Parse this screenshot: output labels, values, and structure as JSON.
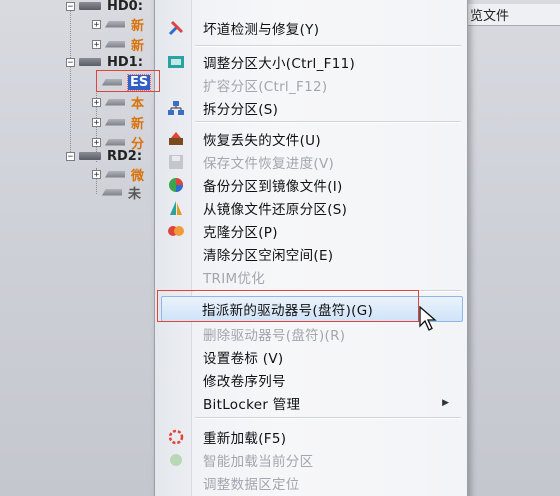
{
  "tree": {
    "hd0_label": "HD0:",
    "hd0_children": [
      "新",
      "新"
    ],
    "hd1_label": "HD1:",
    "hd1_selected": "ES",
    "hd1_children": [
      "本",
      "新",
      "分"
    ],
    "rd2_label": "RD2:",
    "rd2_children": [
      "微",
      "未"
    ]
  },
  "right_header": "览文件",
  "menu": {
    "items": [
      {
        "label": "坏道检测与修复(Y)",
        "disabled": false,
        "icon": "wrench-icon"
      },
      {
        "label": "调整分区大小(Ctrl_F11)",
        "disabled": false,
        "icon": "resize-icon"
      },
      {
        "label": "扩容分区(Ctrl_F12)",
        "disabled": true,
        "icon": ""
      },
      {
        "label": "拆分分区(S)",
        "disabled": false,
        "icon": "split-icon"
      },
      {
        "label": "恢复丢失的文件(U)",
        "disabled": false,
        "icon": "recover-icon"
      },
      {
        "label": "保存文件恢复进度(V)",
        "disabled": true,
        "icon": "save-icon"
      },
      {
        "label": "备份分区到镜像文件(I)",
        "disabled": false,
        "icon": "backup-icon"
      },
      {
        "label": "从镜像文件还原分区(S)",
        "disabled": false,
        "icon": "restore-icon"
      },
      {
        "label": "克隆分区(P)",
        "disabled": false,
        "icon": "clone-icon"
      },
      {
        "label": "清除分区空闲空间(E)",
        "disabled": false,
        "icon": ""
      },
      {
        "label": "TRIM优化",
        "disabled": true,
        "icon": ""
      },
      {
        "label": "指派新的驱动器号(盘符)(G)",
        "disabled": false,
        "icon": "",
        "highlighted": true
      },
      {
        "label": "删除驱动器号(盘符)(R)",
        "disabled": true,
        "icon": ""
      },
      {
        "label": "设置卷标 (V)",
        "disabled": false,
        "icon": ""
      },
      {
        "label": "修改卷序列号",
        "disabled": false,
        "icon": ""
      },
      {
        "label": "BitLocker 管理",
        "disabled": false,
        "icon": "",
        "submenu": true
      },
      {
        "label": "重新加载(F5)",
        "disabled": false,
        "icon": "reload-icon"
      },
      {
        "label": "智能加载当前分区",
        "disabled": true,
        "icon": "smart-load-icon"
      },
      {
        "label": "调整数据区定位",
        "disabled": true,
        "icon": ""
      }
    ]
  }
}
